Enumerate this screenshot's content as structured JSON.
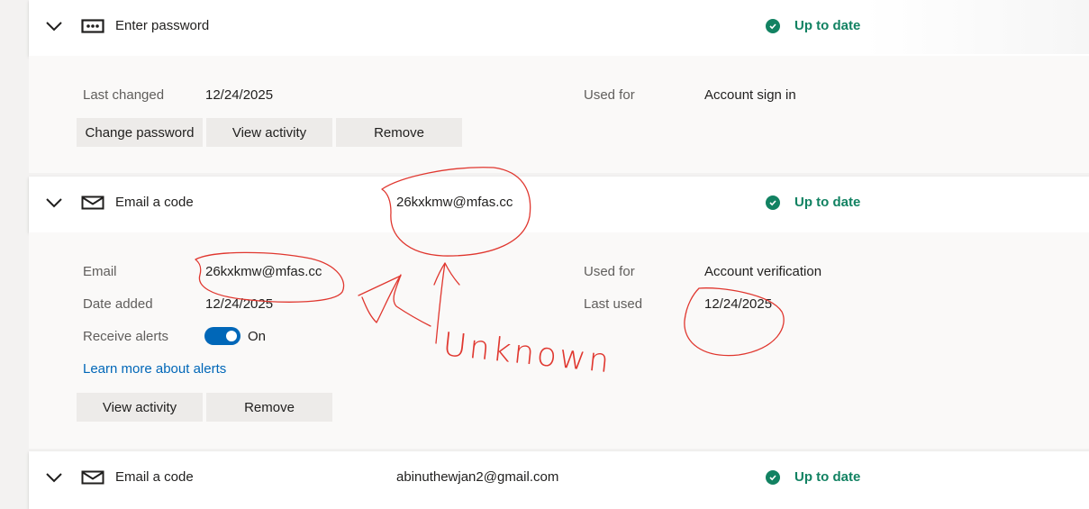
{
  "methods": [
    {
      "type_label": "Enter password",
      "icon": "password-dots-icon",
      "status": "Up to date",
      "details": {
        "last_changed_label": "Last changed",
        "last_changed_value": "12/24/2025",
        "used_for_label": "Used for",
        "used_for_value": "Account sign in"
      },
      "buttons": [
        "Change password",
        "View activity",
        "Remove"
      ]
    },
    {
      "type_label": "Email a code",
      "icon": "mail-icon",
      "detail": "26kxkmw@mfas.cc",
      "status": "Up to date",
      "details": {
        "email_label": "Email",
        "email_value": "26kxkmw@mfas.cc",
        "date_added_label": "Date added",
        "date_added_value": "12/24/2025",
        "receive_alerts_label": "Receive alerts",
        "receive_alerts_value": "On",
        "used_for_label": "Used for",
        "used_for_value": "Account verification",
        "last_used_label": "Last used",
        "last_used_value": "12/24/2025",
        "learn_more_link": "Learn more about alerts"
      },
      "buttons": [
        "View activity",
        "Remove"
      ]
    },
    {
      "type_label": "Email a code",
      "icon": "mail-icon",
      "detail": "abinuthewjan2@gmail.com",
      "status": "Up to date"
    }
  ],
  "annotation": {
    "text": "Unknown",
    "color": "#e0372f"
  },
  "colors": {
    "status_green": "#128262",
    "link_blue": "#0067b8",
    "toggle_blue": "#0067b8"
  }
}
